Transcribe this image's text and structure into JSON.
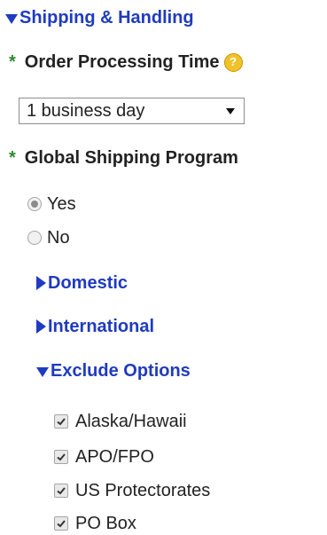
{
  "section": {
    "title": "Shipping & Handling"
  },
  "order_processing": {
    "required_mark": "*",
    "label": "Order Processing Time",
    "help_glyph": "?",
    "selected_value": "1 business day"
  },
  "global_shipping": {
    "required_mark": "*",
    "label": "Global Shipping Program",
    "options": [
      {
        "label": "Yes",
        "selected": true
      },
      {
        "label": "No",
        "selected": false
      }
    ]
  },
  "subsections": {
    "domestic": "Domestic",
    "international": "International",
    "exclude_options": "Exclude Options"
  },
  "exclude_options": [
    {
      "label": "Alaska/Hawaii",
      "checked": true
    },
    {
      "label": "APO/FPO",
      "checked": true
    },
    {
      "label": "US Protectorates",
      "checked": true
    },
    {
      "label": "PO Box",
      "checked": true
    }
  ],
  "colors": {
    "link_blue": "#1f3bbf",
    "required_green": "#2e8b2e",
    "help_yellow": "#f2c22b"
  }
}
